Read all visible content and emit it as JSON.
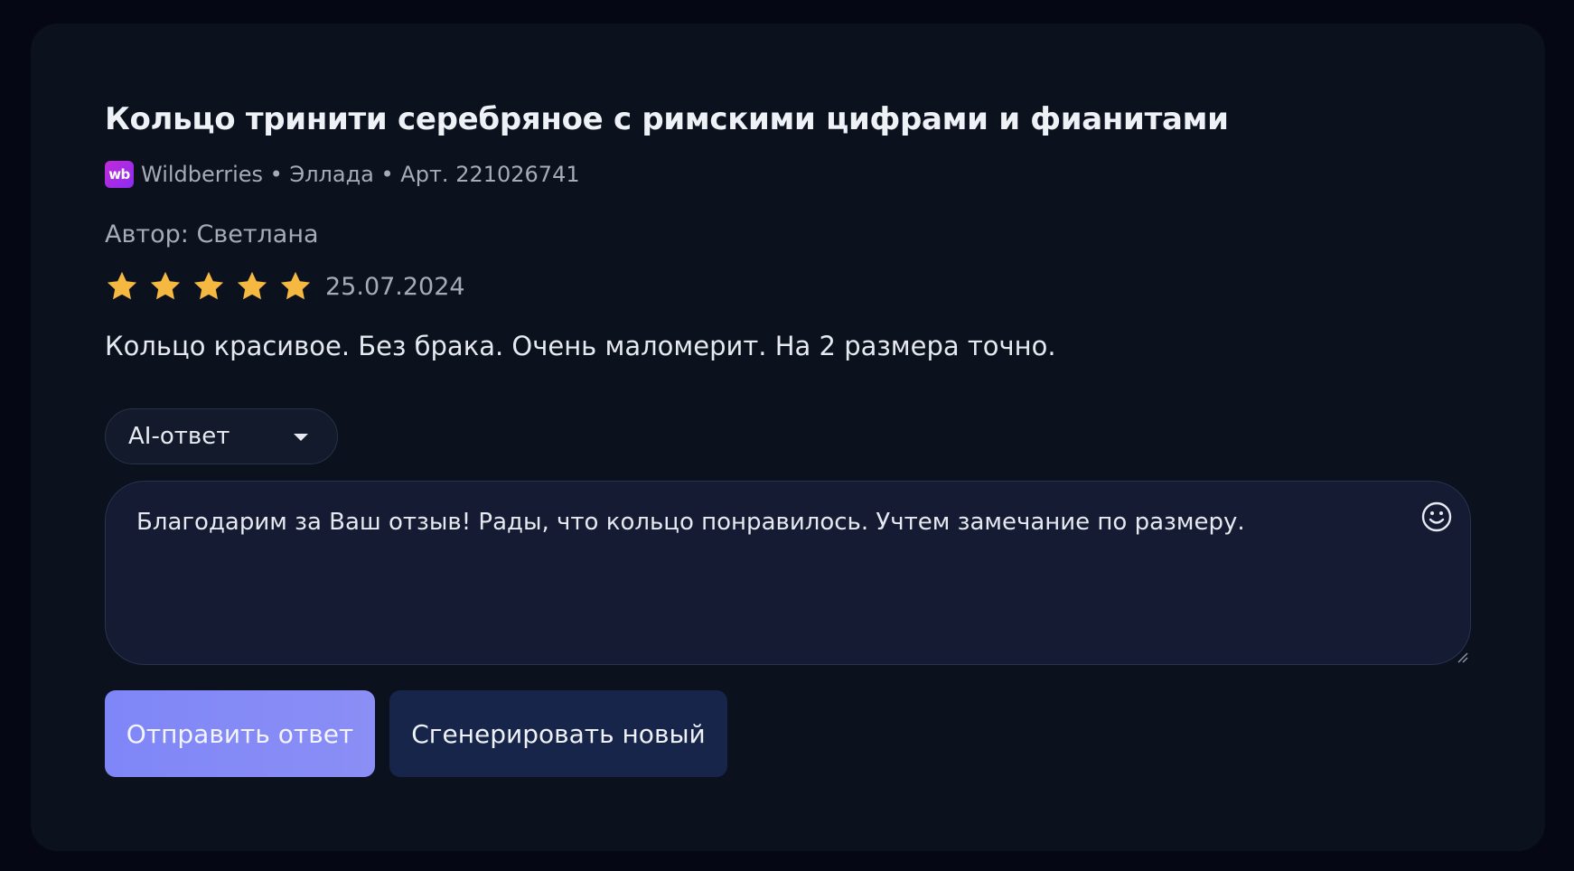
{
  "product": {
    "title": "Кольцо тринити серебряное с римскими цифрами и фианитами",
    "marketplace_logo_text": "wb",
    "meta_line": "Wildberries • Эллада • Арт. 221026741",
    "brand_color": "#a02be6"
  },
  "review": {
    "author_line": "Автор: Светлана",
    "rating": 5,
    "rating_max": 5,
    "star_color": "#f5b942",
    "date": "25.07.2024",
    "text": "Кольцо красивое. Без брака. Очень маломерит. На 2 размера точно."
  },
  "response": {
    "mode_selected": "AI-ответ",
    "reply_text": "Благодарим за Ваш отзыв! Рады, что кольцо понравилось. Учтем замечание по размеру.",
    "emoji_icon": "smiley-icon"
  },
  "actions": {
    "send_label": "Отправить ответ",
    "regenerate_label": "Сгенерировать новый",
    "accent_color": "#8086f7"
  }
}
